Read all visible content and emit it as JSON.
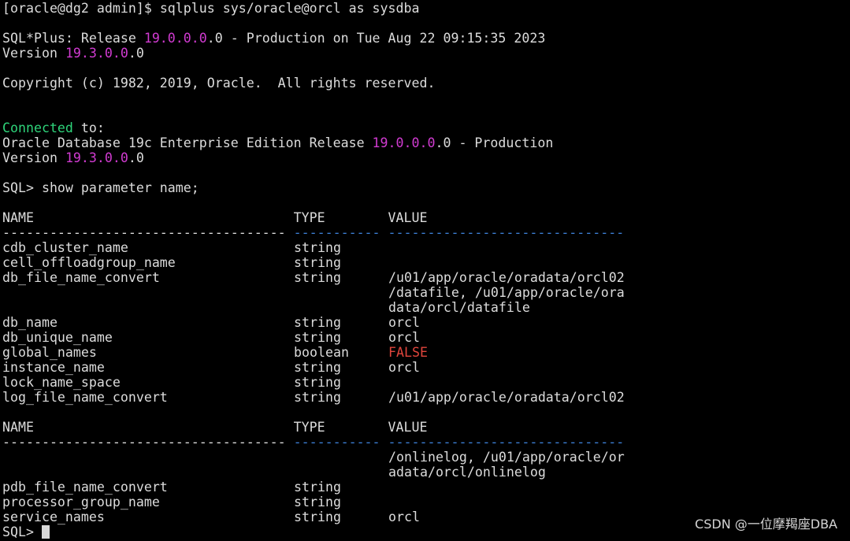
{
  "terminal": {
    "prompt_line": {
      "prompt": "[oracle@dg2 admin]$ ",
      "command": "sqlplus sys/oracle@orcl as sysdba"
    },
    "banner": {
      "l1_a": "SQL*Plus: Release ",
      "l1_ver": "19.0.0.0",
      "l1_b": ".0 - Production on Tue Aug 22 09:15:35 2023",
      "l2_a": "Version ",
      "l2_ver": "19.3.0.0",
      "l2_b": ".0",
      "copyright": "Copyright (c) 1982, 2019, Oracle.  All rights reserved."
    },
    "connection": {
      "connected_word": "Connected",
      "connected_rest": " to:",
      "db_a": "Oracle Database 19c Enterprise Edition Release ",
      "db_ver": "19.0.0.0",
      "db_b": ".0 - Production",
      "ver_a": "Version ",
      "ver_num": "19.3.0.0",
      "ver_b": ".0"
    },
    "query": "SQL> show parameter name;",
    "header": {
      "name": "NAME                                 ",
      "type": "TYPE        ",
      "value": "VALUE"
    },
    "dashes": {
      "name": "------------------------------------ ",
      "type": "----------- ",
      "value": "------------------------------"
    },
    "rows1": [
      {
        "name": "cdb_cluster_name",
        "type": "string",
        "value": ""
      },
      {
        "name": "cell_offloadgroup_name",
        "type": "string",
        "value": ""
      },
      {
        "name": "db_file_name_convert",
        "type": "string",
        "value": "/u01/app/oracle/oradata/orcl02"
      },
      {
        "name": "",
        "type": "",
        "value": "/datafile, /u01/app/oracle/ora"
      },
      {
        "name": "",
        "type": "",
        "value": "data/orcl/datafile"
      },
      {
        "name": "db_name",
        "type": "string",
        "value": "orcl"
      },
      {
        "name": "db_unique_name",
        "type": "string",
        "value": "orcl"
      },
      {
        "name": "global_names",
        "type": "boolean",
        "value": "FALSE"
      },
      {
        "name": "instance_name",
        "type": "string",
        "value": "orcl"
      },
      {
        "name": "lock_name_space",
        "type": "string",
        "value": ""
      },
      {
        "name": "log_file_name_convert",
        "type": "string",
        "value": "/u01/app/oracle/oradata/orcl02"
      }
    ],
    "rows2": [
      {
        "name": "",
        "type": "",
        "value": "/onlinelog, /u01/app/oracle/or"
      },
      {
        "name": "",
        "type": "",
        "value": "adata/orcl/onlinelog"
      },
      {
        "name": "pdb_file_name_convert",
        "type": "string",
        "value": ""
      },
      {
        "name": "processor_group_name",
        "type": "string",
        "value": ""
      },
      {
        "name": "service_names",
        "type": "string",
        "value": "orcl"
      }
    ],
    "final_prompt": "SQL> "
  },
  "watermark": "CSDN @一位摩羯座DBA",
  "colors": {
    "background": "#000000",
    "text": "#dcdcdc",
    "version_number": "#d13bd1",
    "connected": "#2ed47a",
    "false_value": "#e0453c",
    "dash_separator": "#3c7fd6"
  }
}
